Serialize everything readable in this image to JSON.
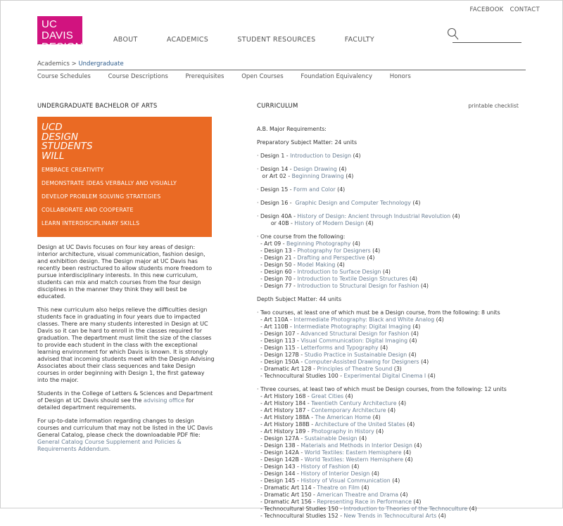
{
  "logo": {
    "line1": "UC DAVIS",
    "line2": "DESIGN"
  },
  "util_nav": [
    "FACEBOOK",
    "CONTACT"
  ],
  "main_nav": [
    "ABOUT",
    "ACADEMICS",
    "STUDENT RESOURCES",
    "FACULTY"
  ],
  "breadcrumb": {
    "parent": "Academics",
    "sep": ">",
    "current": "Undergraduate"
  },
  "sub_nav": [
    "Course Schedules",
    "Course Descriptions",
    "Prerequisites",
    "Open Courses",
    "Foundation Equivalency",
    "Honors"
  ],
  "left": {
    "heading": "UNDERGRADUATE BACHELOR OF ARTS",
    "promo_title": [
      "UCD",
      "DESIGN",
      "STUDENTS",
      "WILL"
    ],
    "promo_points": [
      "EMBRACE CREATIVITY",
      "DEMONSTRATE IDEAS VERBALLY AND VISUALLY",
      "DEVELOP PROBLEM SOLVING STRATEGIES",
      "COLLABORATE AND COOPERATE",
      "LEARN INTERDISCIPLINARY SKILLS"
    ],
    "para1": "Design at UC Davis focuses on four key areas of design: interior architecture, visual communication, fashion design, and exhibition design. The Design major at UC Davis has recently been restructured to allow students more freedom to pursue interdisciplinary interests. In this new curriculum, students can mix and match courses from the four design disciplines in the manner they think they will best be educated.",
    "para2": "This new curriculum also helps relieve the difficulties design students face in graduating in four years due to impacted classes. There are many students interested in Design at UC Davis so it can be hard to enroll in the classes required for graduation. The department must limit the size of the classes to provide each student in the class with the exceptional learning environment for which Davis is known. It is strongly advised that incoming students meet with the Design Advising Associates about their class sequences and take Design courses in order beginning with Design 1, the first gateway into the major.",
    "para3_pre": "Students in the College of Letters & Sciences and Department of Design at UC Davis should see the ",
    "para3_link": "advising office",
    "para3_post": " for detailed department requirements.",
    "para4_pre": "For up-to-date information regarding changes to design courses and curriculum that may not be listed in the UC Davis General Catalog, please check the downloadable PDF file: ",
    "para4_link": "General Catalog Course Supplement and Policies & Requirements Addendum."
  },
  "right": {
    "heading": "CURRICULUM",
    "printable": "printable checklist",
    "major_title": "A.B. Major Requirements:",
    "prep_title": "Preparatory Subject Matter: 24 units",
    "depth_title": "Depth Subject Matter: 44 units",
    "prep_blocks": [
      [
        {
          "pre": "· Design 1 - ",
          "name": "Introduction to Design",
          "post": " (4)"
        }
      ],
      [
        {
          "pre": "· Design 14 - ",
          "name": "Design Drawing",
          "post": " (4)"
        },
        {
          "pre": "   or Art 02 - ",
          "name": "Beginning Drawing",
          "post": " (4)"
        }
      ],
      [
        {
          "pre": "· Design 15 - ",
          "name": "Form and Color",
          "post": " (4)"
        }
      ],
      [
        {
          "pre": "· Design 16 -  ",
          "name": "Graphic Design and Computer Technology",
          "post": " (4)"
        }
      ],
      [
        {
          "pre": "· Design 40A - ",
          "name": "History of Design: Ancient through Industrial Revolution",
          "post": " (4)"
        },
        {
          "pre": "        or 40B - ",
          "name": "History of Modern Design",
          "post": " (4)"
        }
      ],
      [
        {
          "pre": "· One course from the following:",
          "name": "",
          "post": ""
        },
        {
          "pre": "  - Art 09 - ",
          "name": "Beginning Photography",
          "post": " (4)"
        },
        {
          "pre": "  - Design 13 - ",
          "name": "Photography for Designers",
          "post": " (4)"
        },
        {
          "pre": "  - Design 21 - ",
          "name": "Drafting and Perspective",
          "post": " (4)"
        },
        {
          "pre": "  - Design 50 - ",
          "name": "Model Making",
          "post": " (4)"
        },
        {
          "pre": "  - Design 60 - ",
          "name": "Introduction to Surface Design",
          "post": " (4)"
        },
        {
          "pre": "  - Design 70 - ",
          "name": "Introduction to Textile Design Structures",
          "post": " (4)"
        },
        {
          "pre": "  - Design 77 - ",
          "name": "Introduction to Structural Design for Fashion",
          "post": " (4)"
        }
      ]
    ],
    "depth_blocks": [
      [
        {
          "pre": "· Two courses, at least one of which must be a Design course, from the following: 8 units",
          "name": "",
          "post": ""
        },
        {
          "pre": "  - Art 110A - ",
          "name": "Intermediate Photography: Black and White Analog",
          "post": " (4)"
        },
        {
          "pre": "  - Art 110B - ",
          "name": "Intermediate Photography: Digital Imaging",
          "post": " (4)"
        },
        {
          "pre": "  - Design 107 - ",
          "name": "Advanced Structural Design for Fashion",
          "post": " (4)"
        },
        {
          "pre": "  - Design 113 - ",
          "name": "Visual Communication: Digital Imaging",
          "post": " (4)"
        },
        {
          "pre": "  - Design 115 - ",
          "name": "Letterforms and Typography",
          "post": " (4)"
        },
        {
          "pre": "  - Design 127B - ",
          "name": "Studio Practice in Sustainable Design",
          "post": " (4)"
        },
        {
          "pre": "  - Design 150A - ",
          "name": "Computer-Assisted Drawing for Designers",
          "post": " (4)"
        },
        {
          "pre": "  - Dramatic Art 128 - ",
          "name": "Principles of Theatre Sound",
          "post": " (3)"
        },
        {
          "pre": "  - Technocultural Studies 100 - ",
          "name": "Experimental Digital Cinema I",
          "post": " (4)"
        }
      ],
      [
        {
          "pre": "· Three courses, at least two of which must be Design courses, from the following: 12 units",
          "name": "",
          "post": ""
        },
        {
          "pre": "  - Art History 168 - ",
          "name": "Great Cities",
          "post": " (4)"
        },
        {
          "pre": "  - Art History 184 - ",
          "name": "Twentieth Century Architecture",
          "post": " (4)"
        },
        {
          "pre": "  - Art History 187 - ",
          "name": "Contemporary Architecture",
          "post": " (4)"
        },
        {
          "pre": "  - Art History 188A - ",
          "name": "The American Home",
          "post": " (4)"
        },
        {
          "pre": "  - Art History 188B - ",
          "name": "Architecture of the United States",
          "post": " (4)"
        },
        {
          "pre": "  - Art History 189 - ",
          "name": "Photography in History",
          "post": " (4)"
        },
        {
          "pre": "  - Design 127A - ",
          "name": "Sustainable Design",
          "post": " (4)"
        },
        {
          "pre": "  - Design 138 - ",
          "name": "Materials and Methods in Interior Design",
          "post": " (4)"
        },
        {
          "pre": "  - Design 142A - ",
          "name": "World Textiles: Eastern Hemisphere",
          "post": " (4)"
        },
        {
          "pre": "  - Design 142B - ",
          "name": "World Textiles: Western Hemisphere",
          "post": " (4)"
        },
        {
          "pre": "  - Design 143 - ",
          "name": "History of Fashion",
          "post": " (4)"
        },
        {
          "pre": "  - Design 144 - ",
          "name": "History of Interior Design",
          "post": " (4)"
        },
        {
          "pre": "  - Design 145 - ",
          "name": "History of Visual Communication",
          "post": " (4)"
        },
        {
          "pre": "  - Dramatic Art 114 - ",
          "name": "Theatre on Film",
          "post": " (4)"
        },
        {
          "pre": "  - Dramatic Art 150 - ",
          "name": "American Theatre and Drama",
          "post": " (4)"
        },
        {
          "pre": "  - Dramatic Art 156 - ",
          "name": "Representing Race in Performance",
          "post": " (4)"
        },
        {
          "pre": "  - Technocultural Studies 150 - ",
          "name": "Introduction to Theories of the Technoculture",
          "post": " (4)"
        },
        {
          "pre": "  - Technocultural Studies 152 - ",
          "name": "New Trends in Technocultural Arts",
          "post": " (4)"
        }
      ]
    ]
  },
  "colors": {
    "brand_magenta": "#d1137f",
    "promo_orange": "#ea6a24",
    "link_gray_blue": "#6a7f95",
    "breadcrumb_blue": "#2b5a8a"
  }
}
